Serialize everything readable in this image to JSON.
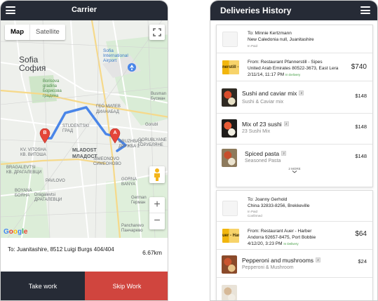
{
  "left_screen": {
    "header": {
      "title": "Carrier"
    },
    "map": {
      "type_tabs": [
        "Map",
        "Satellite"
      ],
      "labels": {
        "sofia_latin": "Sofia",
        "sofia_cyr": "София",
        "airport": "Sofia\nInternational\nAirport",
        "borisova": "Borisova\ngradina\nБорисова\nградина",
        "mladost_latin": "MLADOST",
        "mladost_cyr": "МЛАДОСТ",
        "vitosha": "KV. VITOSHA\nКВ. ВИТОША",
        "bragalevtsi": "BRAGALEVTSI\nКВ. ДРАГАЛЕВЦИ",
        "studentski": "STUDENTSKI\nГРАД",
        "druzhba": "DRUZHBA 2\nДРУЖБА 2",
        "geo_milev": "ГЕО МИЛЕВ",
        "dianabad": "ДИАНАБАД",
        "busman": "Busman\nБусман",
        "gorubl": "Gorubl",
        "gorublyane": "GORUBLYANE\nГОРУБЛЯНЕ",
        "gorna_banya": "GORNA\nBANYA",
        "pancharevo": "Pancharevo\nПанчарево",
        "simeonovo": "SIMEONOVO\nСИМЕОНОВО",
        "german": "German\nГерман",
        "boyana": "BOYANA\nБОЯНА",
        "dragalevtsi": "Dragalevtsi\nДРАГАЛЕВЦИ",
        "pavlovo": "PAVLOVO"
      },
      "marker_a": "A",
      "marker_b": "B",
      "zoom_in": "+",
      "zoom_out": "−",
      "attribution": "Google"
    },
    "destination": "To: Juanitashire, 8512 Luigi Burgs 404/404",
    "distance": "6.67km",
    "actions": {
      "take": "Take work",
      "skip": "Skip Work"
    }
  },
  "right_screen": {
    "header": {
      "title": "Deliveries History"
    },
    "deliveries": [
      {
        "to_name": "To: Minnie Kertzmann",
        "to_address": "New Caledonia null, Juanitashire",
        "status": "In Paid",
        "confirmed": "",
        "restaurant": "From: Restaurant Pfannerstill - Sipes",
        "restaurant_logo": "nerstill - S",
        "restaurant_address": "United Arab Emirates 80522-3673, East Lera",
        "datetime": "2/11/14, 11:17 PM",
        "delivery_status": "In Delivery",
        "total": "$740",
        "items": [
          {
            "name": "Sushi and caviar mix",
            "qty": "2",
            "sub": "Sushi & Caviar mix",
            "price": "$148",
            "colors": [
              "#2f2a23",
              "#d84c2c",
              "#e7e0c6"
            ]
          },
          {
            "name": "Mix of 23 sushi",
            "qty": "2",
            "sub": "23 Sushi Mix",
            "price": "$148",
            "colors": [
              "#1e1c1a",
              "#e85b36",
              "#f1eee2"
            ]
          },
          {
            "name": "Spiced pasta",
            "qty": "2",
            "sub": "Seasoned Pasta",
            "price": "$148",
            "colors": [
              "#8d7a5c",
              "#c84e2c",
              "#ebe3cf"
            ]
          }
        ],
        "more": "2 MORE"
      },
      {
        "to_name": "To: Joanny Gerhold",
        "to_address": "China 32833-8256, Brekkeville",
        "status": "In Paid",
        "confirmed": "Confirmed",
        "restaurant": "From: Restaurant Auer - Harber",
        "restaurant_logo": "uer - Harb",
        "restaurant_address": "Andorra 92657-8475, Port Bobbie",
        "datetime": "4/12/20, 3:23 PM",
        "delivery_status": "In Delivery",
        "total": "$64",
        "items": [
          {
            "name": "Pepperoni and mushrooms",
            "qty": "2",
            "sub": "Pepperoni & Mushroom",
            "price": "$24",
            "colors": [
              "#8a4a2a",
              "#c9552f",
              "#e8c48a"
            ]
          },
          {
            "name": "",
            "qty": "",
            "sub": "",
            "price": "",
            "colors": [
              "#e9e3d8",
              "#d6b997",
              "#f1ede4"
            ]
          }
        ],
        "more": ""
      }
    ]
  },
  "colors": {
    "header": "#262b36",
    "skip": "#d0453e",
    "route": "#4a86e8",
    "marker": "#e5453a",
    "delivery_green": "#3c9a3c"
  }
}
